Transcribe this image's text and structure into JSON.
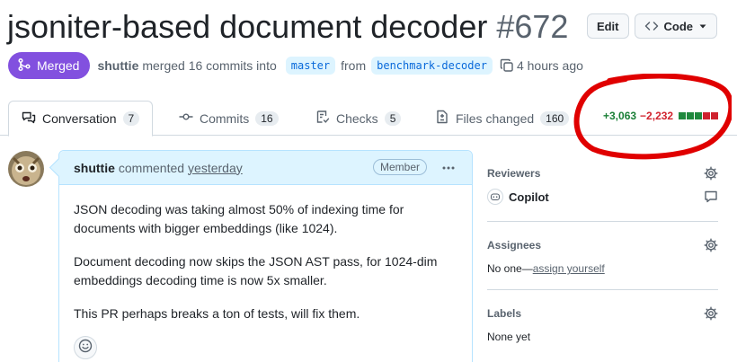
{
  "pr": {
    "title": "jsoniter-based document decoder",
    "number": "#672",
    "edit_label": "Edit",
    "code_label": "Code",
    "state": "Merged",
    "author": "shuttie",
    "merge_text": "merged 16 commits into",
    "base_branch": "master",
    "from_word": "from",
    "head_branch": "benchmark-decoder",
    "time_ago": "4 hours ago"
  },
  "tabs": [
    {
      "label": "Conversation",
      "count": "7",
      "icon": "comment-discussion-icon"
    },
    {
      "label": "Commits",
      "count": "16",
      "icon": "git-commit-icon"
    },
    {
      "label": "Checks",
      "count": "5",
      "icon": "checklist-icon"
    },
    {
      "label": "Files changed",
      "count": "160",
      "icon": "file-diff-icon"
    }
  ],
  "diffstat": {
    "additions": "+3,063",
    "deletions": "−2,232",
    "blocks": [
      "green",
      "green",
      "green",
      "red",
      "red"
    ],
    "colors": {
      "green": "#1f883d",
      "red": "#cf222e"
    }
  },
  "comment": {
    "author": "shuttie",
    "action": "commented",
    "time": "yesterday",
    "role": "Member",
    "paragraphs": [
      "JSON decoding was taking almost 50% of indexing time for documents with bigger embeddings (like 1024).",
      "Document decoding now skips the JSON AST pass, for 1024-dim embeddings decoding time is now 5x smaller.",
      "This PR perhaps breaks a ton of tests, will fix them."
    ]
  },
  "sidebar": {
    "reviewers": {
      "heading": "Reviewers",
      "name": "Copilot"
    },
    "assignees": {
      "heading": "Assignees",
      "none": "No one—",
      "link": "assign yourself"
    },
    "labels": {
      "heading": "Labels",
      "value": "None yet"
    }
  },
  "colors": {
    "merged": "#8250df",
    "annotation": "#e00000",
    "comment_header": "#ddf4ff"
  }
}
